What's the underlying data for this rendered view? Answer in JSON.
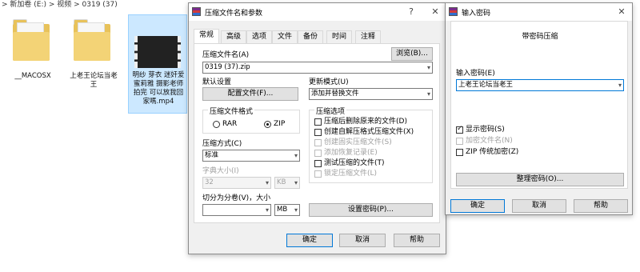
{
  "explorer": {
    "breadcrumb": "> 新加卷 (E:) > 视频 > 0319 (37)",
    "files": [
      {
        "name": "__MACOSX"
      },
      {
        "name": "上老王论坛当老王"
      },
      {
        "name": "明纱 芽衣 迷奸爱蜜莉雅 摄影老师拍完 可以放我回家嗎.mp4"
      }
    ]
  },
  "archive_dialog": {
    "title": "压缩文件名和参数",
    "help_btn": "?",
    "close_btn": "✕",
    "tabs": [
      "常规",
      "高级",
      "选项",
      "文件",
      "备份",
      "时间",
      "注释"
    ],
    "archive_name_label": "压缩文件名(A)",
    "browse_btn": "浏览(B)...",
    "archive_name_value": "0319 (37).zip",
    "default_settings_label": "默认设置",
    "profiles_btn": "配置文件(F)...",
    "update_mode_label": "更新模式(U)",
    "update_mode_value": "添加并替换文件",
    "format_group": "压缩文件格式",
    "format_rar": "RAR",
    "format_zip": "ZIP",
    "method_label": "压缩方式(C)",
    "method_value": "标准",
    "dict_label": "字典大小(I)",
    "dict_value": "32",
    "dict_unit": "KB",
    "split_label": "切分为分卷(V)，大小",
    "split_value": "",
    "split_unit": "MB",
    "options_group": "压缩选项",
    "options": [
      {
        "label": "压缩后删除原来的文件(D)",
        "checked": false,
        "enabled": true
      },
      {
        "label": "创建自解压格式压缩文件(X)",
        "checked": false,
        "enabled": true
      },
      {
        "label": "创建固实压缩文件(S)",
        "checked": false,
        "enabled": false
      },
      {
        "label": "添加恢复记录(E)",
        "checked": false,
        "enabled": false
      },
      {
        "label": "测试压缩的文件(T)",
        "checked": false,
        "enabled": true
      },
      {
        "label": "锁定压缩文件(L)",
        "checked": false,
        "enabled": false
      }
    ],
    "set_password_btn": "设置密码(P)...",
    "ok_btn": "确定",
    "cancel_btn": "取消",
    "help_button": "帮助"
  },
  "password_dialog": {
    "title": "输入密码",
    "close_btn": "✕",
    "heading": "带密码压缩",
    "password_label": "输入密码(E)",
    "password_value": "上老王论坛当老王",
    "show_password": "显示密码(S)",
    "encrypt_names": "加密文件名(N)",
    "zip_legacy": "ZIP 传统加密(Z)",
    "organize_btn": "整理密码(O)...",
    "ok_btn": "确定",
    "cancel_btn": "取消",
    "help_btn": "帮助"
  },
  "colors": {
    "selection": "#cce8ff",
    "folder": "#e8c25a",
    "accent": "#0078d7"
  }
}
